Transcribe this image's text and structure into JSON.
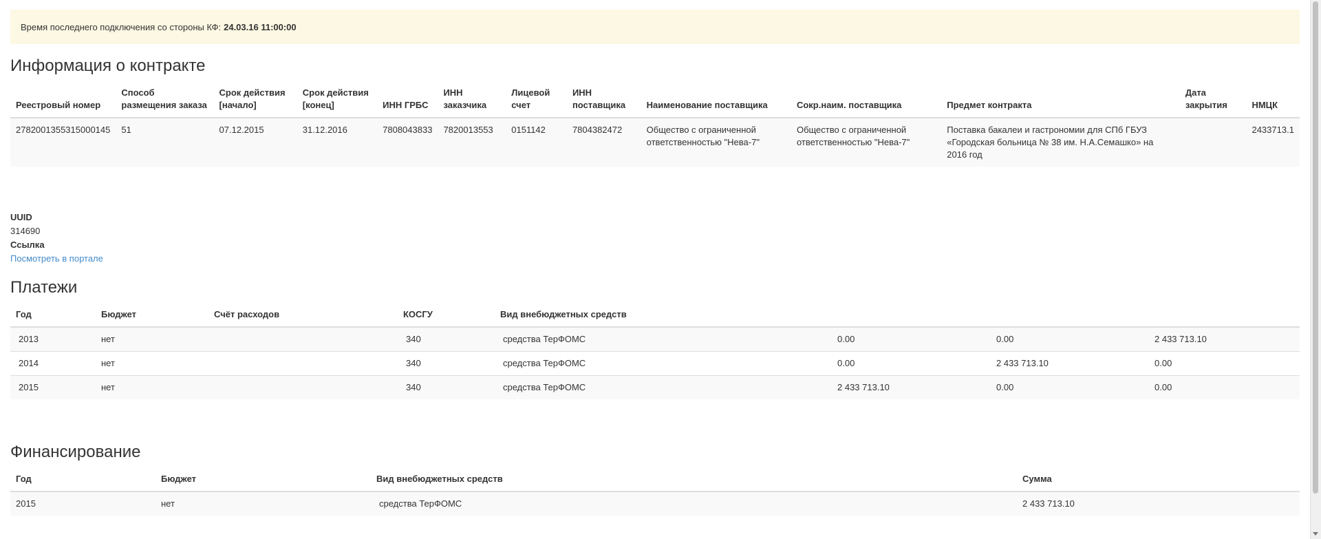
{
  "alert": {
    "label": "Время последнего подключения со стороны КФ:",
    "value": "24.03.16 11:00:00"
  },
  "contract": {
    "title": "Информация о контракте",
    "headers": [
      "Реестровый номер",
      "Способ размещения заказа",
      "Срок действия [начало]",
      "Срок действия [конец]",
      "ИНН ГРБС",
      "ИНН заказчика",
      "Лицевой счет",
      "ИНН поставщика",
      "Наименование поставщика",
      "Сокр.наим. поставщика",
      "Предмет контракта",
      "Дата закрытия",
      "НМЦК"
    ],
    "row": [
      "2782001355315000145",
      "51",
      "07.12.2015",
      "31.12.2016",
      "7808043833",
      "7820013553",
      "0151142",
      "7804382472",
      "Общество с ограниченной ответственностью \"Нева-7\"",
      "Общество с ограниченной ответственностью \"Нева-7\"",
      "Поставка бакалеи и гастрономии для СПб ГБУЗ «Городская больница № 38 им. Н.А.Семашко» на 2016 год",
      "",
      "2433713.1"
    ]
  },
  "info": {
    "uuid_label": "UUID",
    "uuid_value": "314690",
    "link_label": "Ссылка",
    "link_text": "Посмотреть в портале"
  },
  "payments": {
    "title": "Платежи",
    "headers": [
      "Год",
      "Бюджет",
      "Счёт расходов",
      "КОСГУ",
      "Вид внебюджетных средств",
      "",
      "",
      ""
    ],
    "rows": [
      [
        "2013",
        "нет",
        "",
        "340",
        "средства ТерФОМС",
        "0.00",
        "0.00",
        "2 433 713.10"
      ],
      [
        "2014",
        "нет",
        "",
        "340",
        "средства ТерФОМС",
        "0.00",
        "2 433 713.10",
        "0.00"
      ],
      [
        "2015",
        "нет",
        "",
        "340",
        "средства ТерФОМС",
        "2 433 713.10",
        "0.00",
        "0.00"
      ]
    ]
  },
  "financing": {
    "title": "Финансирование",
    "headers": [
      "Год",
      "Бюджет",
      "Вид внебюджетных средств",
      "Сумма"
    ],
    "rows": [
      [
        "2015",
        "нет",
        "средства ТерФОМС",
        "2 433 713.10"
      ]
    ]
  }
}
